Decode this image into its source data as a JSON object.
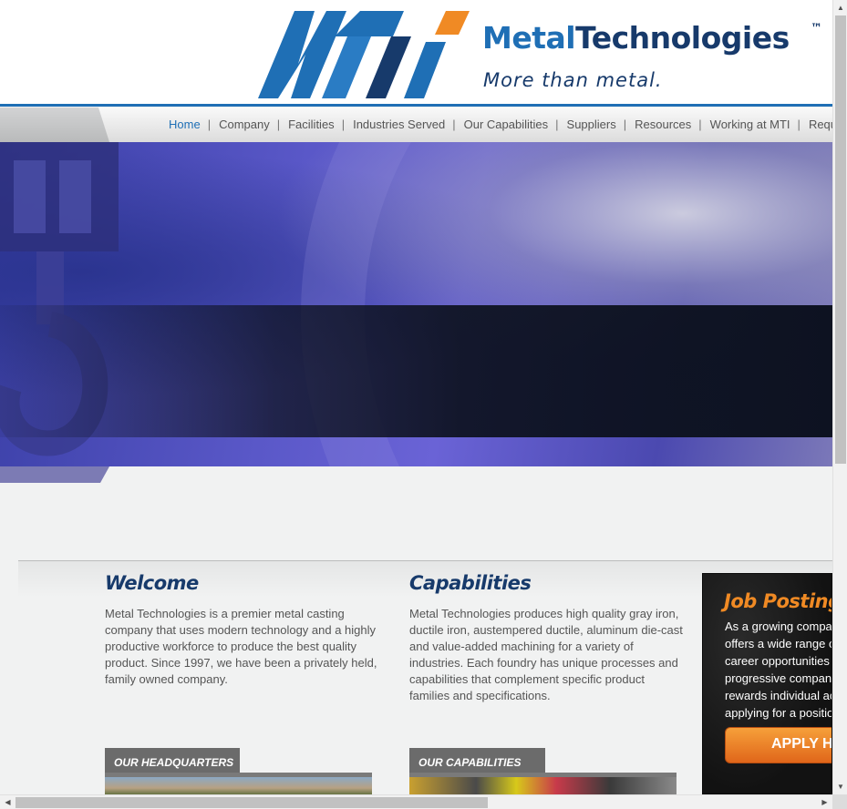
{
  "header": {
    "brand_metal": "Metal",
    "brand_technologies": "Technologies",
    "trademark": "™",
    "tagline": "More than metal.",
    "logo_letters": "MTi",
    "colors": {
      "primary_blue": "#1f6fb5",
      "navy": "#173a6b",
      "orange": "#f08a24"
    }
  },
  "nav": {
    "items": [
      {
        "label": "Home",
        "active": true
      },
      {
        "label": "Company"
      },
      {
        "label": "Facilities"
      },
      {
        "label": "Industries Served"
      },
      {
        "label": "Our Capabilities"
      },
      {
        "label": "Suppliers"
      },
      {
        "label": "Resources"
      },
      {
        "label": "Working at MTI"
      },
      {
        "label": "Request Quote"
      }
    ],
    "separator": "|"
  },
  "welcome": {
    "title": "Welcome",
    "body": "Metal Technologies is a premier metal casting company that uses modern technology and a highly productive workforce to produce the best quality product. Since 1997, we have been a privately held, family owned company."
  },
  "capabilities": {
    "title": "Capabilities",
    "body": "Metal Technologies produces high quality gray iron, ductile iron, austempered ductile, aluminum die-cast and value-added machining for a variety of industries. Each foundry has unique processes and capabilities that complement specific product families and specifications."
  },
  "thumbs": {
    "headquarters_label": "OUR HEADQUARTERS",
    "capabilities_label": "OUR CAPABILITIES"
  },
  "jobs": {
    "title": "Job Postings",
    "lines": [
      "As a growing company",
      "offers a wide range of",
      "career opportunities",
      "progressive company",
      "rewards individual ac",
      "applying for a position"
    ],
    "button_label": "APPLY HERE"
  },
  "scrollbars": {
    "up_arrow": "▲",
    "down_arrow": "▼",
    "left_arrow": "◀",
    "right_arrow": "▶"
  }
}
